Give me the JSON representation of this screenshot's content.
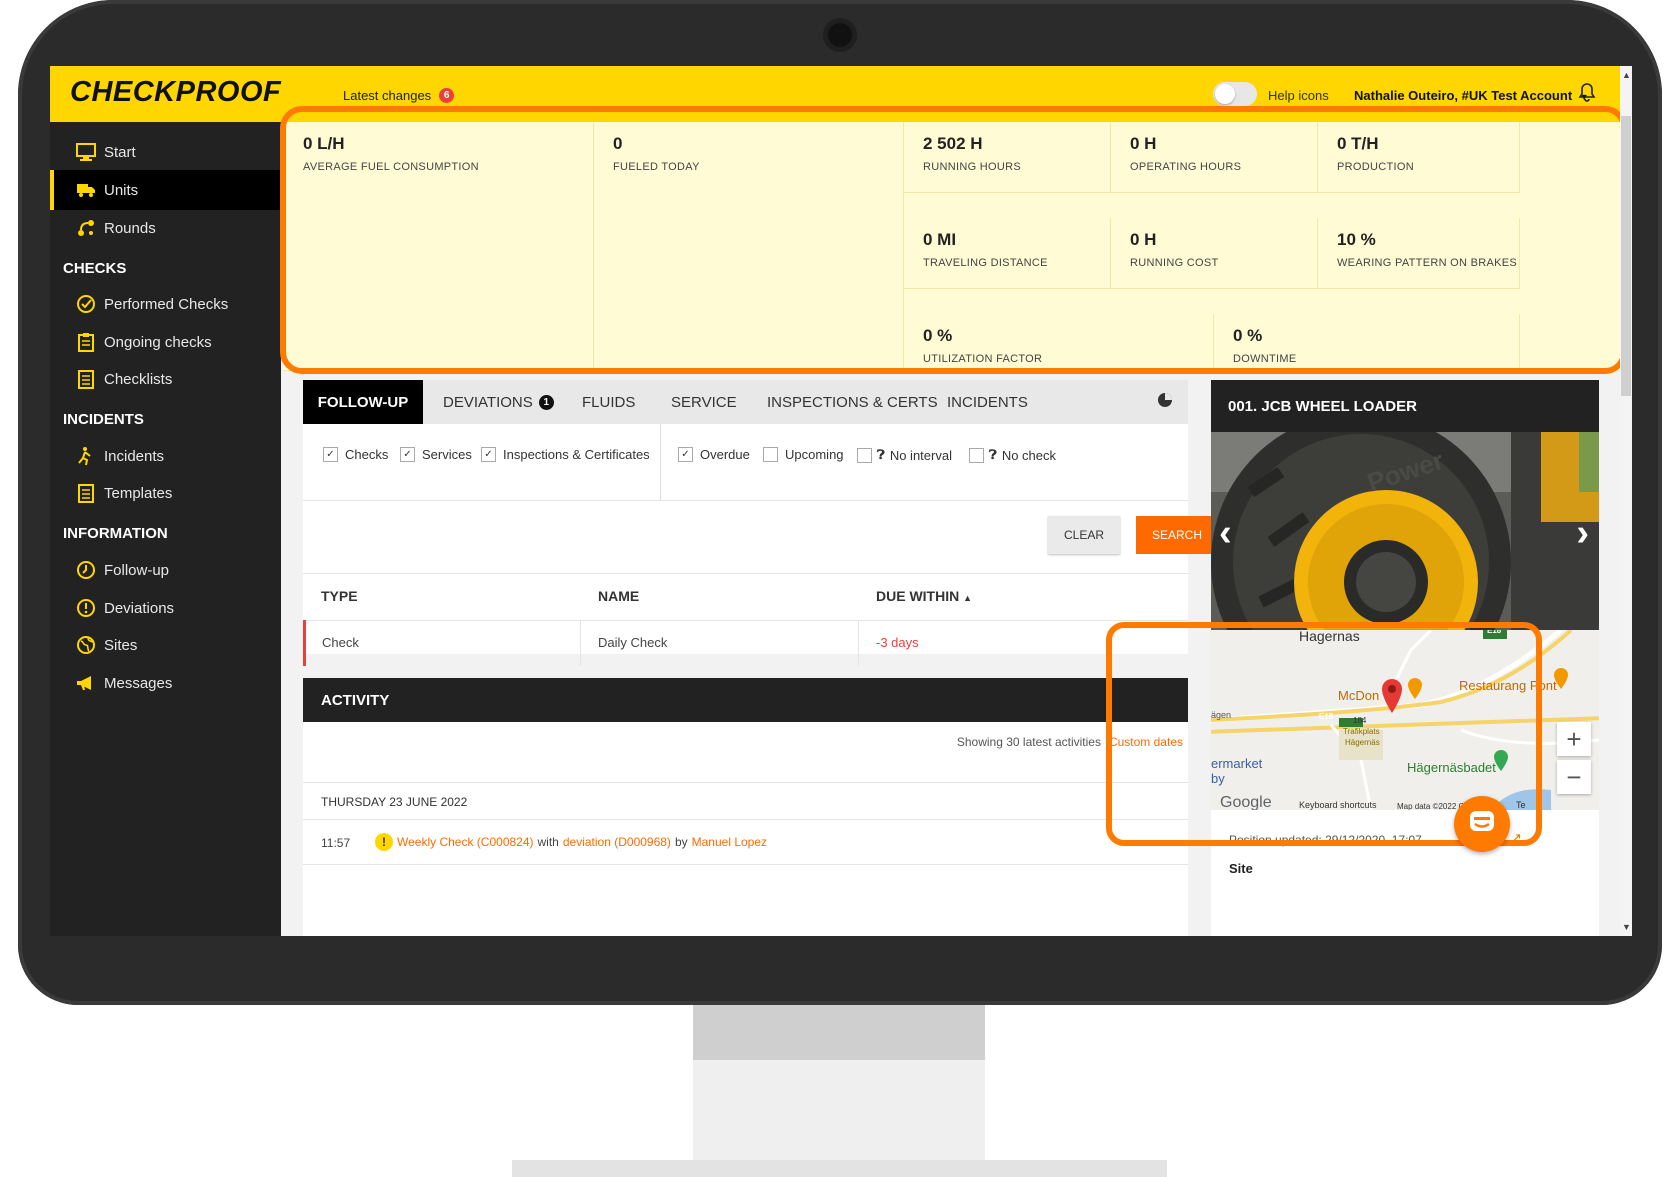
{
  "brand": {
    "logo": "CHECKPROOF",
    "accent": "#ffd600",
    "orange": "#ff6a00"
  },
  "topbar": {
    "latest_changes": "Latest changes",
    "latest_count": "6",
    "help_icons": "Help icons",
    "user": "Nathalie Outeiro, #UK Test Account"
  },
  "sidebar": {
    "items": [
      {
        "label": "Start",
        "icon": "monitor-icon"
      },
      {
        "label": "Units",
        "icon": "truck-icon"
      },
      {
        "label": "Rounds",
        "icon": "route-icon"
      }
    ],
    "checks_title": "CHECKS",
    "checks": [
      {
        "label": "Performed Checks",
        "icon": "check-circle-icon"
      },
      {
        "label": "Ongoing checks",
        "icon": "clipboard-icon"
      },
      {
        "label": "Checklists",
        "icon": "checklist-icon"
      }
    ],
    "incidents_title": "INCIDENTS",
    "incidents": [
      {
        "label": "Incidents",
        "icon": "incident-icon"
      },
      {
        "label": "Templates",
        "icon": "template-icon"
      }
    ],
    "information_title": "INFORMATION",
    "information": [
      {
        "label": "Follow-up",
        "icon": "clock-icon"
      },
      {
        "label": "Deviations",
        "icon": "warning-circle-icon"
      },
      {
        "label": "Sites",
        "icon": "globe-icon"
      },
      {
        "label": "Messages",
        "icon": "megaphone-icon"
      }
    ]
  },
  "stats": [
    {
      "value": "0 L/H",
      "label": "AVERAGE FUEL CONSUMPTION"
    },
    {
      "value": "0",
      "label": "FUELED TODAY"
    },
    {
      "value": "2 502 H",
      "label": "RUNNING HOURS"
    },
    {
      "value": "0 H",
      "label": "OPERATING HOURS"
    },
    {
      "value": "0 T/H",
      "label": "PRODUCTION"
    },
    {
      "value": "0 MI",
      "label": "TRAVELING DISTANCE"
    },
    {
      "value": "0 H",
      "label": "RUNNING COST"
    },
    {
      "value": "10 %",
      "label": "WEARING PATTERN ON BRAKES"
    },
    {
      "value": "0 %",
      "label": "UTILIZATION FACTOR"
    },
    {
      "value": "0 %",
      "label": "DOWNTIME"
    }
  ],
  "tabs": [
    {
      "label": "FOLLOW-UP"
    },
    {
      "label": "DEVIATIONS",
      "badge": "1"
    },
    {
      "label": "FLUIDS"
    },
    {
      "label": "SERVICE"
    },
    {
      "label": "INSPECTIONS & CERTS"
    },
    {
      "label": "INCIDENTS"
    }
  ],
  "filters": {
    "checks": "Checks",
    "services": "Services",
    "inspections": "Inspections & Certificates",
    "overdue": "Overdue",
    "upcoming": "Upcoming",
    "no_interval": "No interval",
    "no_check": "No check"
  },
  "buttons": {
    "clear": "CLEAR",
    "search": "SEARCH"
  },
  "table": {
    "headers": [
      "TYPE",
      "NAME",
      "DUE WITHIN"
    ],
    "rows": [
      {
        "type": "Check",
        "name": "Daily Check",
        "due": "-3 days"
      }
    ]
  },
  "activity": {
    "title": "ACTIVITY",
    "showing": "Showing 30 latest activities",
    "custom_dates": "Custom dates",
    "date": "THURSDAY 23 JUNE 2022",
    "entry": {
      "time": "11:57",
      "check": "Weekly Check (C000824)",
      "with": "with",
      "deviation": "deviation (D000968)",
      "by": "by",
      "person": "Manuel Lopez"
    }
  },
  "unit": {
    "title": "001. JCB WHEEL LOADER",
    "map": {
      "place_top": "Hagernas",
      "restaurant": "Restaurang Pont",
      "mcd": "McDon",
      "road_e18": "E18",
      "road_184": "184",
      "traffic": "Trafikplats",
      "traffic2": "Hägernäs",
      "bad": "Hägernäsbadet",
      "market": "ermarket",
      "by": "by",
      "west": "ägen",
      "google": "Google",
      "keyboard": "Keyboard shortcuts",
      "mapdata": "Map data ©2022 Google",
      "terms": "Te"
    },
    "position_updated": "Position updated: 29/12/2020, 17:07",
    "site_label": "Site"
  }
}
